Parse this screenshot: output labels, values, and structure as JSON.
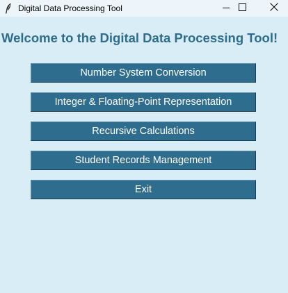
{
  "window": {
    "title": "Digital Data Processing Tool"
  },
  "main": {
    "heading": "Welcome to the Digital Data Processing Tool!",
    "buttons": [
      {
        "label": "Number System Conversion"
      },
      {
        "label": "Integer & Floating-Point Representation"
      },
      {
        "label": "Recursive Calculations"
      },
      {
        "label": "Student Records Management"
      },
      {
        "label": "Exit"
      }
    ]
  },
  "icons": {
    "app": "feather-icon",
    "minimize": "minimize-icon",
    "maximize": "maximize-icon",
    "close": "close-icon"
  },
  "colors": {
    "background": "#d9edf6",
    "accent": "#2e6d8e",
    "button_text": "#ffffff"
  }
}
